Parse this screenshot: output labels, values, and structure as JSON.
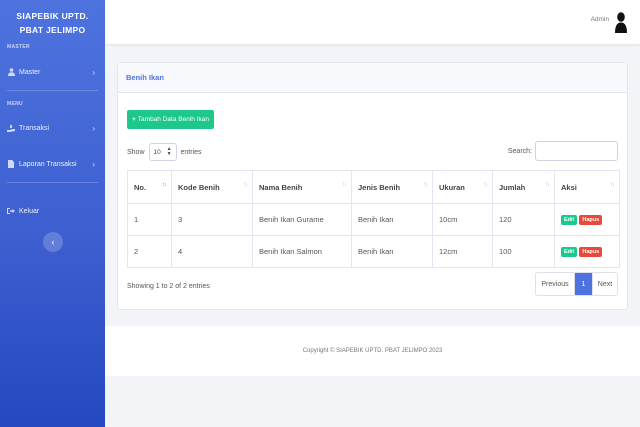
{
  "sidebar": {
    "brand_line1": "SIAPEBIK UPTD.",
    "brand_line2": "PBAT JELIMPO",
    "heading_master": "MASTER",
    "heading_menu": "MENU",
    "items": [
      {
        "label": "Master",
        "icon": "user-icon"
      },
      {
        "label": "Transaksi",
        "icon": "hand-icon"
      },
      {
        "label": "Laporan Transaksi",
        "icon": "file-icon"
      },
      {
        "label": "Keluar",
        "icon": "logout-icon"
      }
    ],
    "toggle_icon": "‹"
  },
  "topbar": {
    "user_name": "Admin"
  },
  "card": {
    "title": "Benih Ikan",
    "add_button": "Tambah Data Benih Ikan",
    "show_label": "Show",
    "entries_label": "entries",
    "page_size": "10",
    "search_label": "Search:",
    "search_value": ""
  },
  "table": {
    "columns": [
      "No.",
      "Kode Benih",
      "Nama Benih",
      "Jenis Benih",
      "Ukuran",
      "Jumlah",
      "Aksi"
    ],
    "rows": [
      {
        "no": "1",
        "kode": "3",
        "nama": "Benih Ikan Gurame",
        "jenis": "Benih Ikan",
        "ukuran": "10cm",
        "jumlah": "120"
      },
      {
        "no": "2",
        "kode": "4",
        "nama": "Benih Ikan Salmon",
        "jenis": "Benih Ikan",
        "ukuran": "12cm",
        "jumlah": "100"
      }
    ],
    "edit_label": "Edit",
    "delete_label": "Hapus"
  },
  "pagination": {
    "info": "Showing 1 to 2 of 2 entries",
    "previous": "Previous",
    "current": "1",
    "next": "Next"
  },
  "footer": {
    "text": "Copyright © SIAPEBIK UPTD. PBAT JELIMPO 2023"
  },
  "colors": {
    "primary": "#4e73df",
    "success": "#1cc88a",
    "danger": "#e74a3b"
  }
}
